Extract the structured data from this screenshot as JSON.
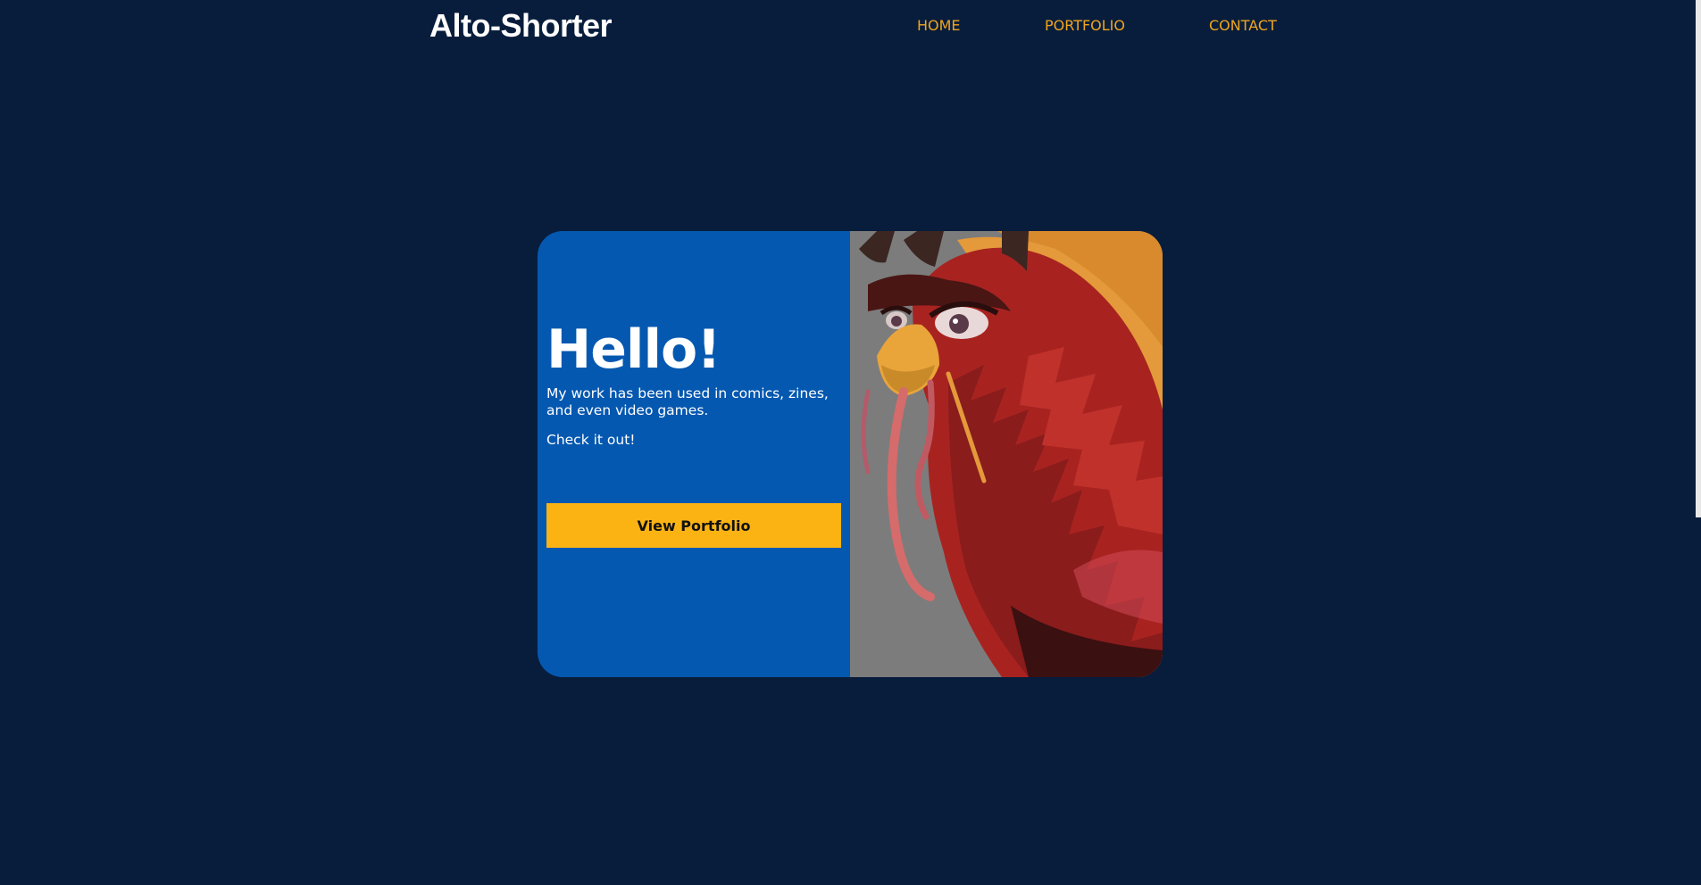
{
  "header": {
    "logo": "Alto-Shorter",
    "nav": [
      "HOME",
      "PORTFOLIO",
      "CONTACT"
    ]
  },
  "hero": {
    "title": "Hello!",
    "intro": "My work has been used in comics, zines, and even video games.",
    "cta_text": "Check it out!",
    "button_label": "View Portfolio"
  },
  "illustration": {
    "subject": "red-bird-character-illustration"
  },
  "colors": {
    "page_background": "#081d3c",
    "card_panel": "#0458b0",
    "nav_link": "#f0a51e",
    "button": "#fbb314",
    "image_background": "#7c7c7c"
  }
}
